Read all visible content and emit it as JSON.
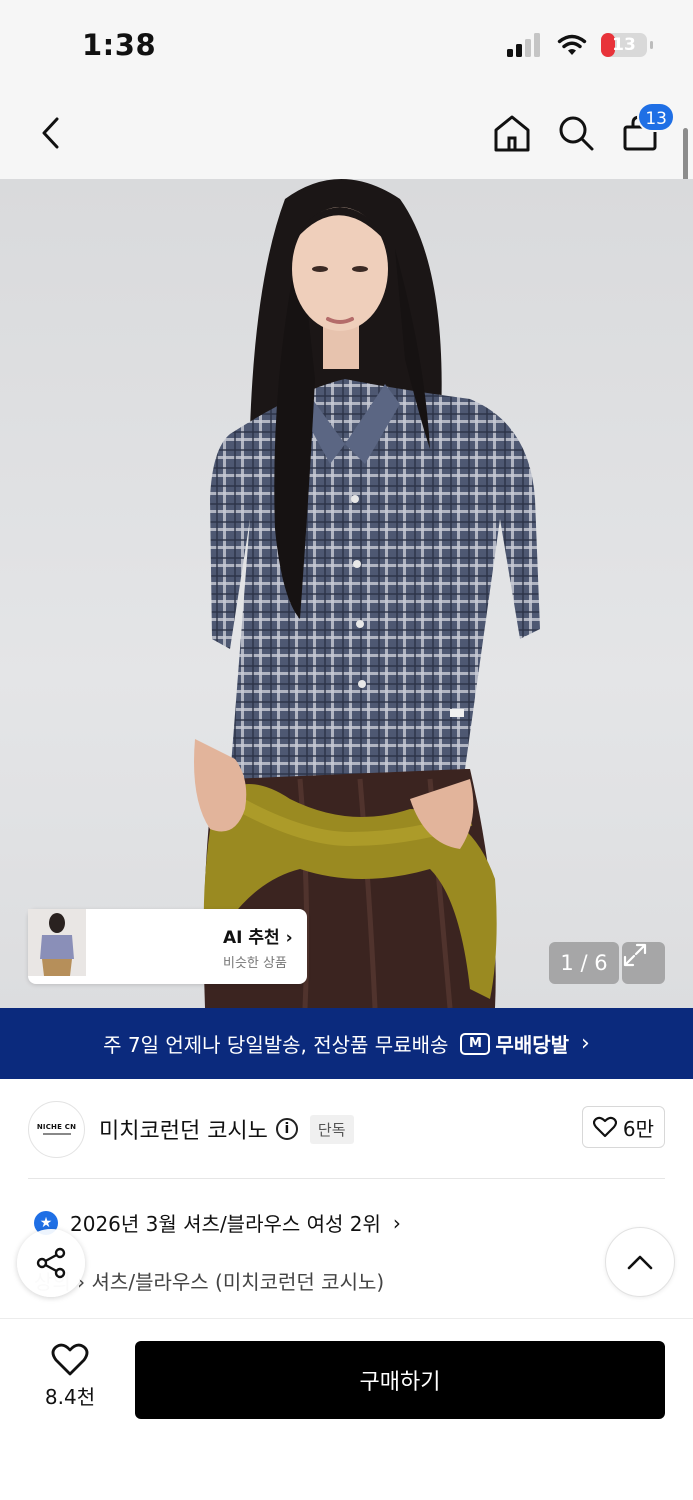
{
  "status_bar": {
    "time": "1:38",
    "battery_level": "13",
    "battery_fraction": 0.13
  },
  "nav": {
    "cart_badge": "13"
  },
  "hero": {
    "page_counter": "1 / 6",
    "ai_card": {
      "title": "AI 추천",
      "subtitle": "비슷한 상품"
    }
  },
  "banner": {
    "text": "주 7일 언제나 당일발송, 전상품 무료배송",
    "badge_letter": "M",
    "badge_label": "무배당발"
  },
  "brand": {
    "logo_text": "NICHE CN",
    "name": "미치코런던 코시노",
    "tag": "단독",
    "like_count": "6만"
  },
  "ranking": {
    "text": "2026년 3월 셔츠/블라우스 여성 2위"
  },
  "category": {
    "home": "상의",
    "text": "셔츠/블라우스 (미치코런던 코시노)"
  },
  "bottom_bar": {
    "wish_count": "8.4천",
    "buy_label": "구매하기"
  },
  "colors": {
    "banner_bg": "#0b2a7d",
    "badge_blue": "#1f6fe5",
    "buy_bg": "#000000"
  },
  "icons": [
    "back-icon",
    "home-icon",
    "search-icon",
    "bag-icon",
    "expand-icon",
    "info-icon",
    "heart-icon",
    "share-icon",
    "chevron-up-icon",
    "star-badge-icon"
  ]
}
